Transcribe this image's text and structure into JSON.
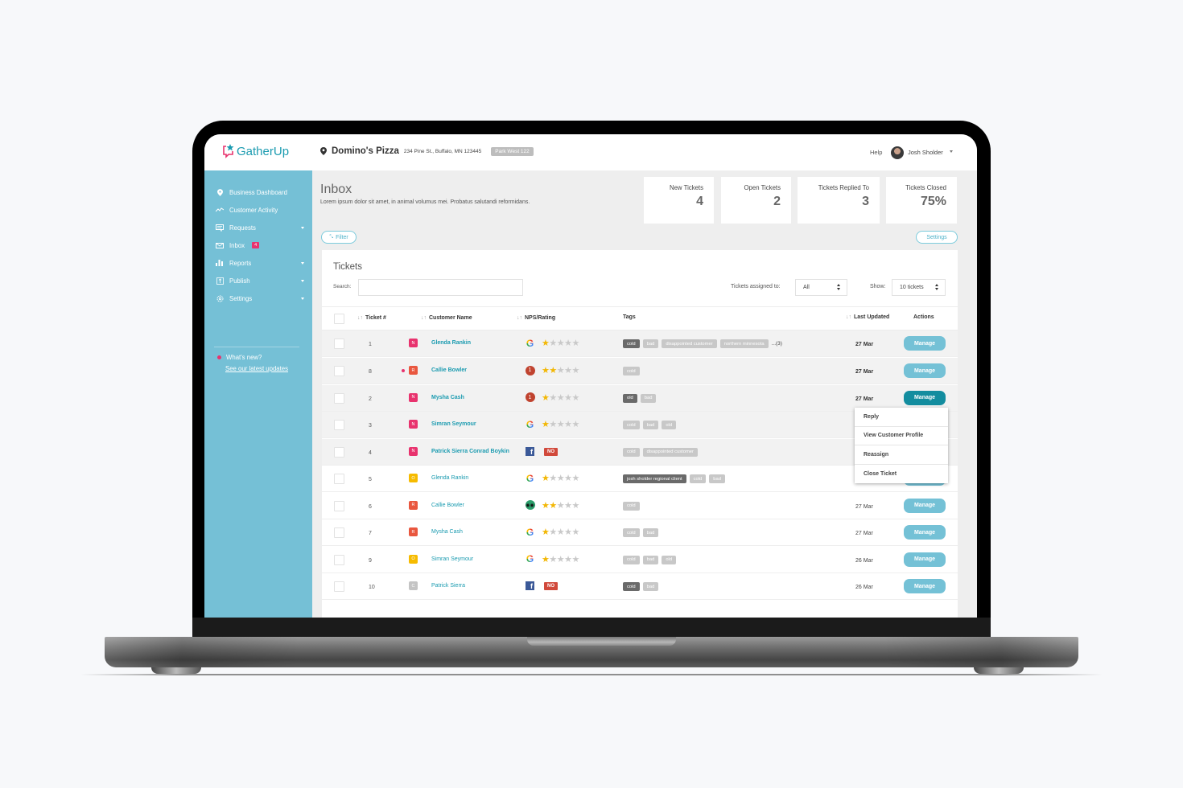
{
  "app": {
    "brand": "GatherUp",
    "brand_color": "#1b9bb0",
    "accent_pink": "#e8336e",
    "sidebar_color": "#75c0d6"
  },
  "topbar": {
    "location_name": "Domino's Pizza",
    "location_address": "234 Pine St., Buffalo, MN 123445",
    "location_badge": "Park West 122",
    "help_label": "Help",
    "user_name": "Josh Sholder"
  },
  "sidebar": {
    "items": [
      {
        "label": "Business Dashboard",
        "icon": "map-pin-icon"
      },
      {
        "label": "Customer Activity",
        "icon": "activity-icon"
      },
      {
        "label": "Requests",
        "icon": "message-icon",
        "has_caret": true
      },
      {
        "label": "Inbox",
        "icon": "mail-icon",
        "badge": "4"
      },
      {
        "label": "Reports",
        "icon": "bar-chart-icon",
        "has_caret": true
      },
      {
        "label": "Publish",
        "icon": "upload-icon",
        "has_caret": true
      },
      {
        "label": "Settings",
        "icon": "gear-icon",
        "has_caret": true
      }
    ],
    "whats_new": "What's new?",
    "updates_link": "See our latest updates"
  },
  "page": {
    "title": "Inbox",
    "description": "Lorem ipsum dolor sit amet, in animal volumus mei. Probatus salutandi reformidans.",
    "filter_label": "Filter",
    "settings_label": "Settings"
  },
  "stats": [
    {
      "label": "New Tickets",
      "value": "4"
    },
    {
      "label": "Open Tickets",
      "value": "2"
    },
    {
      "label": "Tickets Replied To",
      "value": "3"
    },
    {
      "label": "Tickets Closed",
      "value": "75%"
    }
  ],
  "tickets": {
    "title": "Tickets",
    "search_label": "Search:",
    "search_value": "",
    "assigned_label": "Tickets assigned to:",
    "assigned_value": "All",
    "show_label": "Show:",
    "show_value": "10 tickets",
    "columns": {
      "ticket": "Ticket #",
      "customer": "Customer Name",
      "rating": "NPS/Rating",
      "tags": "Tags",
      "updated": "Last Updated",
      "actions": "Actions"
    },
    "sort_glyph": "↓↑",
    "manage_label": "Manage",
    "rows": [
      {
        "num": "1",
        "status": "N",
        "customer": "Glenda Rankin",
        "unread": true,
        "source": "google",
        "stars": 1,
        "tags": [
          {
            "t": "cold",
            "dark": true
          },
          {
            "t": "bad"
          },
          {
            "t": "disappointed customer"
          },
          {
            "t": "northern minnesota"
          }
        ],
        "more": "...(3)",
        "date": "27 Mar"
      },
      {
        "num": "8",
        "status": "R",
        "customer": "Callie Bowler",
        "unread": true,
        "dot": true,
        "source": "nps",
        "stars": 2,
        "tags": [
          {
            "t": "cold"
          }
        ],
        "date": "27 Mar"
      },
      {
        "num": "2",
        "status": "N",
        "customer": "Mysha Cash",
        "unread": true,
        "source": "nps",
        "stars": 1,
        "tags": [
          {
            "t": "old",
            "dark": true
          },
          {
            "t": "bad"
          }
        ],
        "date": "27 Mar",
        "active": true
      },
      {
        "num": "3",
        "status": "N",
        "customer": "Simran Seymour",
        "unread": true,
        "source": "google",
        "stars": 1,
        "tags": [
          {
            "t": "cold"
          },
          {
            "t": "bad"
          },
          {
            "t": "old"
          }
        ],
        "date": ""
      },
      {
        "num": "4",
        "status": "N",
        "customer": "Patrick Sierra Conrad Boykin",
        "unread": true,
        "source": "facebook",
        "recommend": "NO",
        "tags": [
          {
            "t": "cold"
          },
          {
            "t": "disappointed customer"
          }
        ],
        "date": ""
      },
      {
        "num": "5",
        "status": "O",
        "customer": "Glenda Rankin",
        "source": "google",
        "stars": 1,
        "tags": [
          {
            "t": "josh sholder regional client",
            "dark": true
          },
          {
            "t": "cold"
          },
          {
            "t": "bad"
          }
        ],
        "date": ""
      },
      {
        "num": "6",
        "status": "R",
        "customer": "Callie Bowler",
        "source": "tripadvisor",
        "stars": 2,
        "tags": [
          {
            "t": "cold"
          }
        ],
        "date": "27 Mar"
      },
      {
        "num": "7",
        "status": "R",
        "customer": "Mysha Cash",
        "source": "google",
        "stars": 1,
        "tags": [
          {
            "t": "cold"
          },
          {
            "t": "bad"
          }
        ],
        "date": "27 Mar"
      },
      {
        "num": "9",
        "status": "O",
        "customer": "Simran Seymour",
        "source": "google",
        "stars": 1,
        "tags": [
          {
            "t": "cold"
          },
          {
            "t": "bad"
          },
          {
            "t": "old"
          }
        ],
        "date": "26 Mar"
      },
      {
        "num": "10",
        "status": "C",
        "customer": "Patrick Sierra",
        "source": "facebook",
        "recommend": "NO",
        "tags": [
          {
            "t": "cold",
            "dark": true
          },
          {
            "t": "bad"
          }
        ],
        "date": "26 Mar"
      }
    ],
    "status_colors": {
      "N": "#e8336e",
      "R": "#e9573f",
      "O": "#f6bb00",
      "C": "#c4c4c4"
    },
    "nps_value": "1"
  },
  "action_menu": {
    "items": [
      "Reply",
      "View Customer Profile",
      "Reassign",
      "Close Ticket"
    ]
  }
}
